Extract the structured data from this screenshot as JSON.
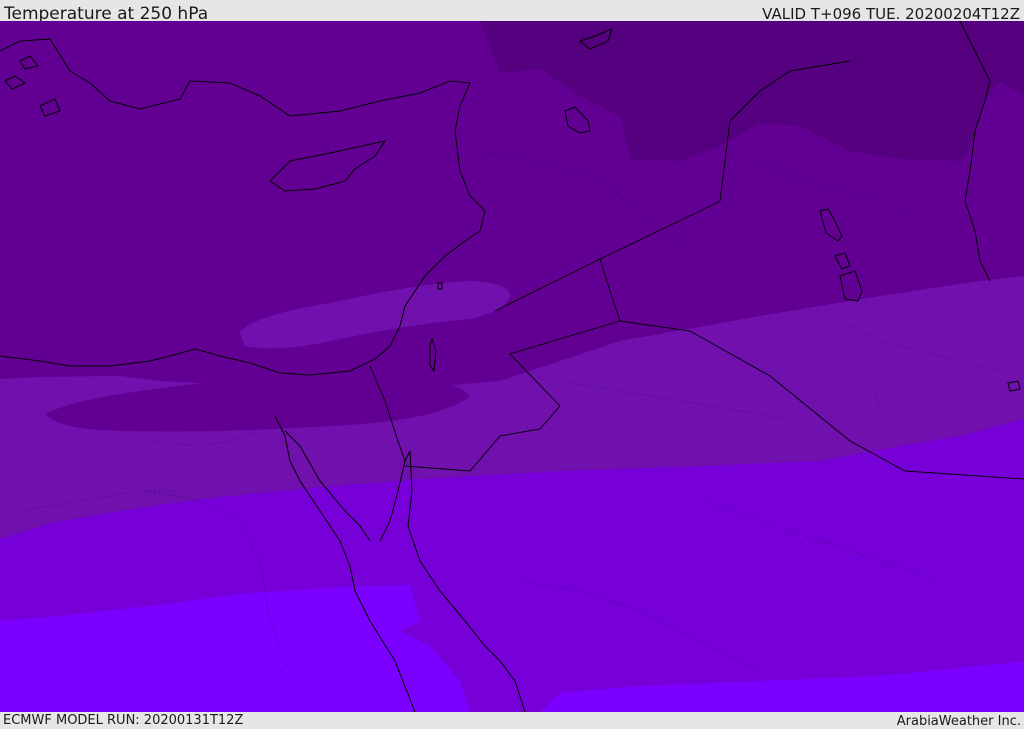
{
  "header": {
    "title": "Temperature at 250 hPa",
    "valid": "VALID T+096 TUE. 20200204T12Z"
  },
  "footer": {
    "model_run": "ECMWF MODEL RUN: 20200131T12Z",
    "credit": "ArabiaWeather Inc."
  },
  "map": {
    "field": "temperature-250hPa",
    "bands": [
      {
        "name": "coldest",
        "color": "#54007f"
      },
      {
        "name": "very-cold",
        "color": "#630094"
      },
      {
        "name": "cold",
        "color": "#7011ad"
      },
      {
        "name": "cool",
        "color": "#7700d8"
      },
      {
        "name": "warmest",
        "color": "#7b00ff"
      }
    ],
    "line_color": "#000000"
  }
}
